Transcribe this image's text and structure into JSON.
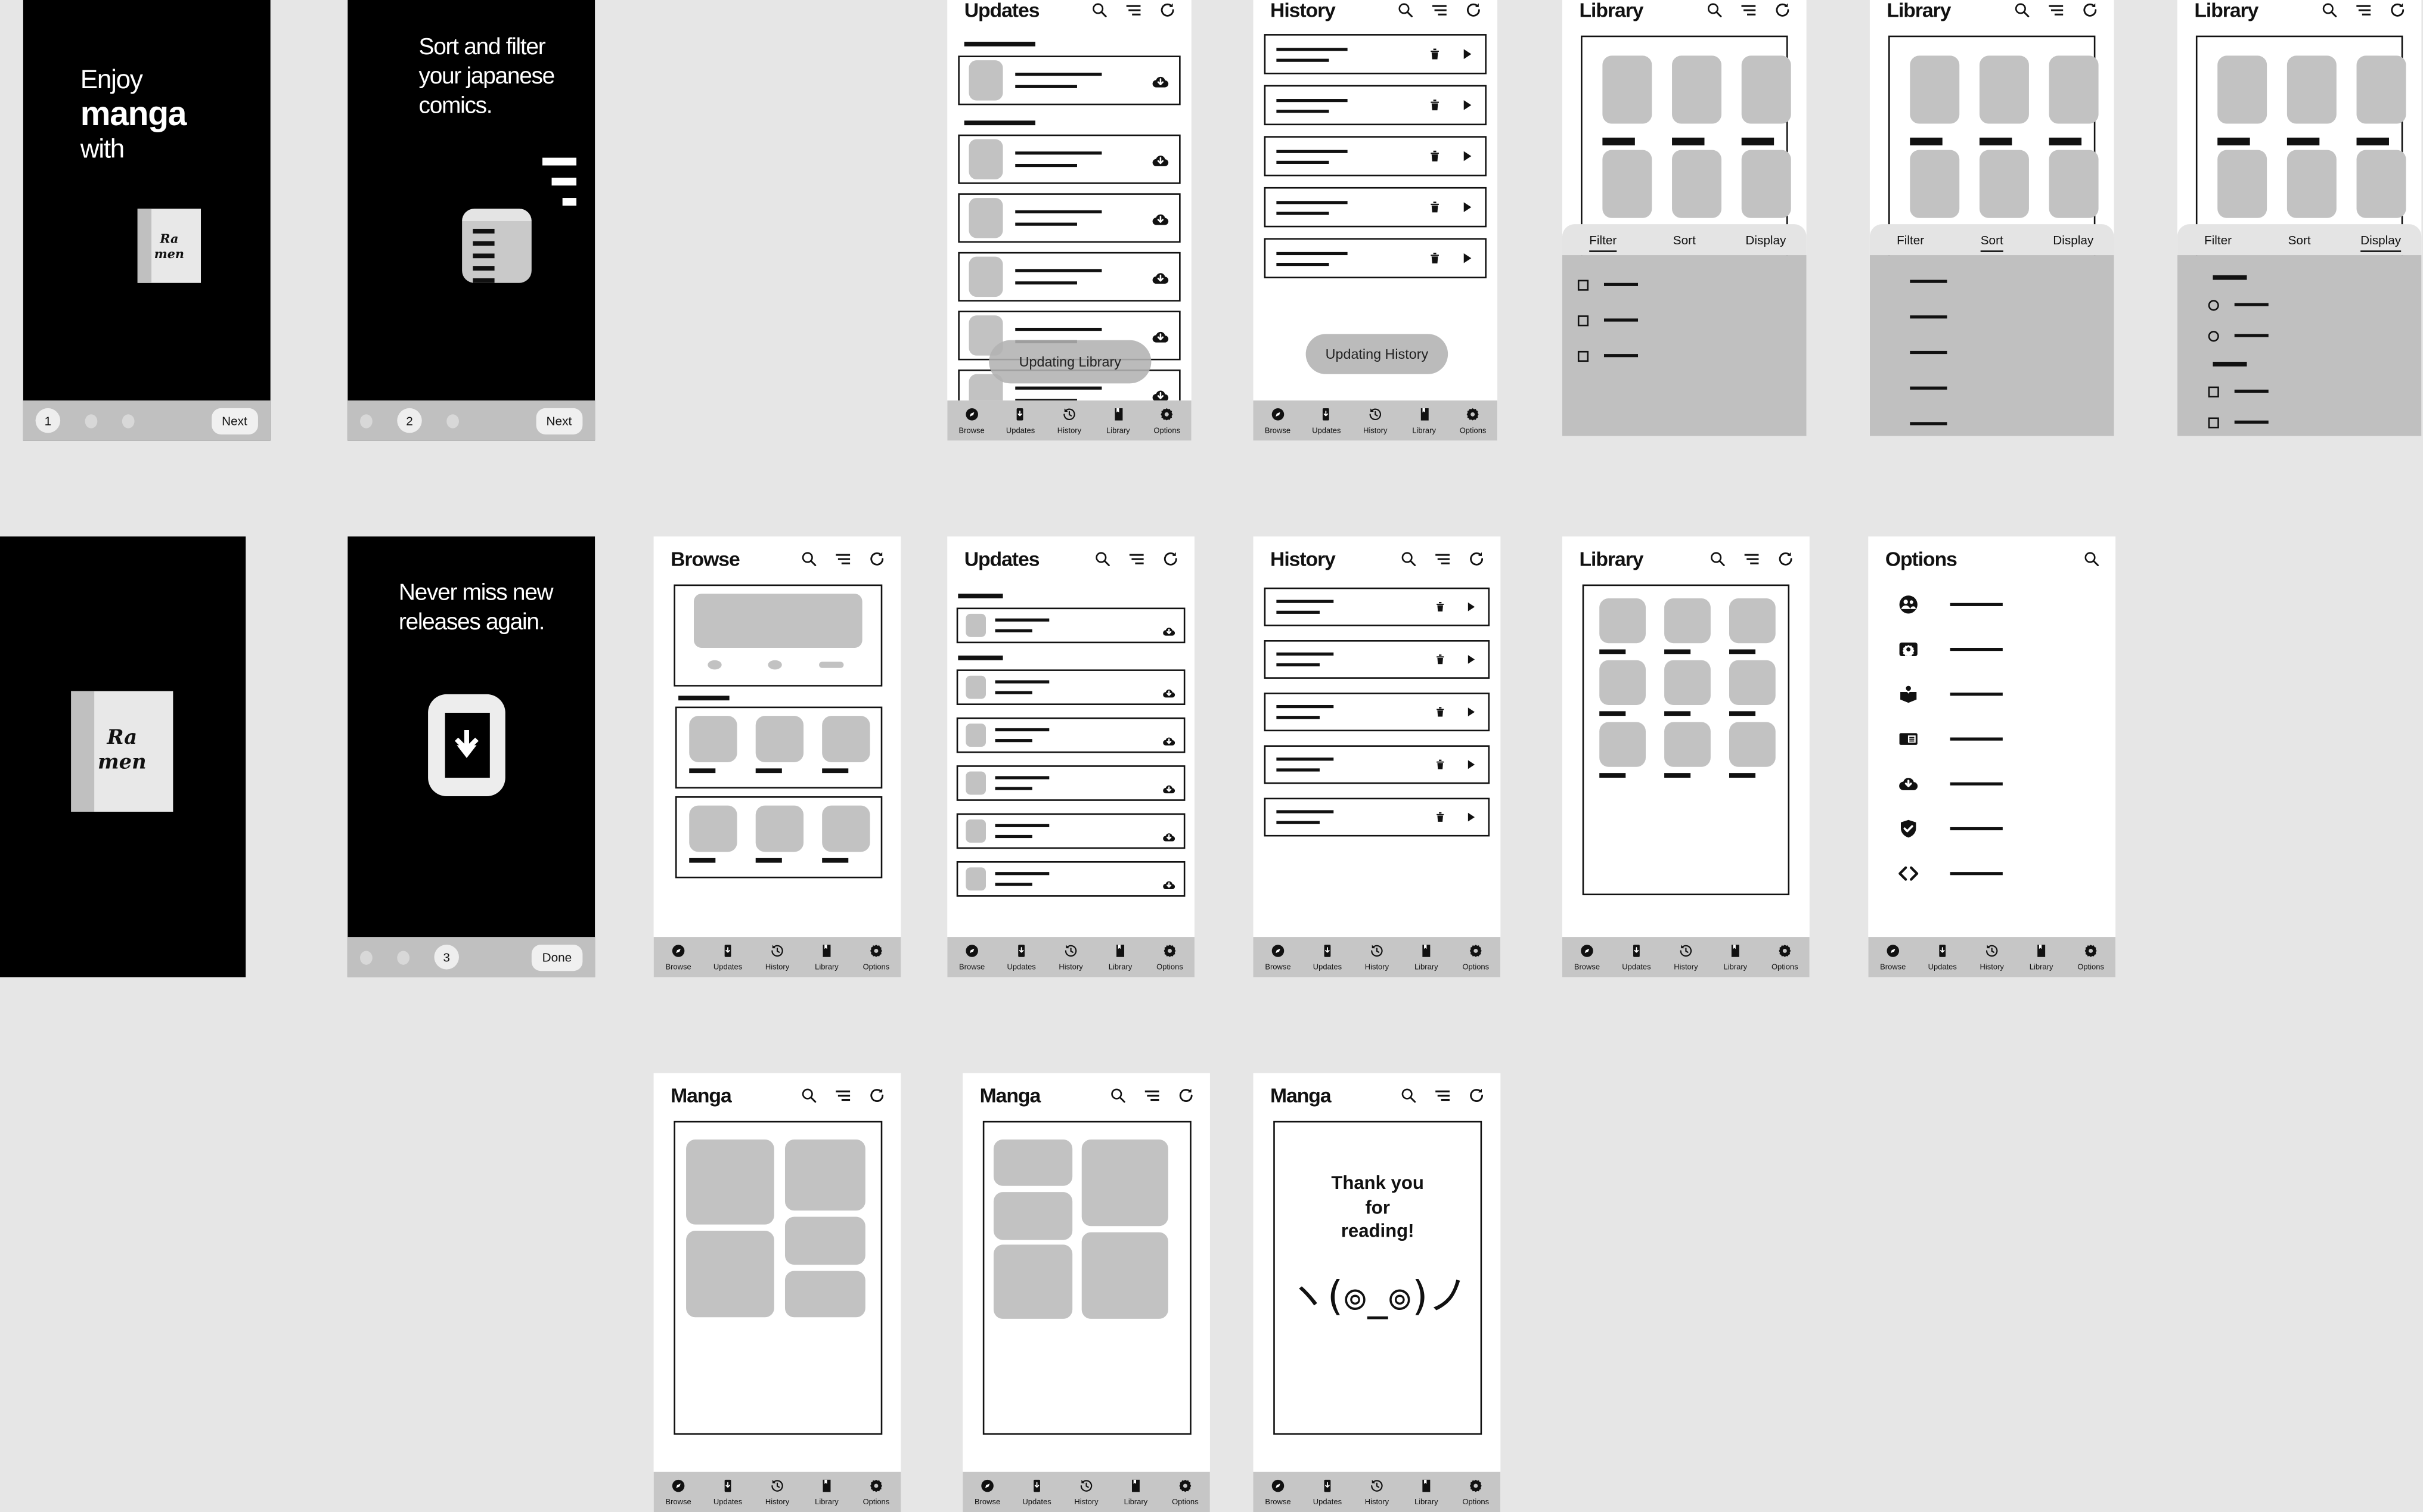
{
  "app": {
    "nav_items": [
      {
        "label": "Browse",
        "icon": "compass-icon"
      },
      {
        "label": "Updates",
        "icon": "phone-download-icon"
      },
      {
        "label": "History",
        "icon": "clock-rewind-icon"
      },
      {
        "label": "Library",
        "icon": "book-icon"
      },
      {
        "label": "Options",
        "icon": "gear-icon"
      }
    ],
    "bar_icons": [
      {
        "name": "search-icon"
      },
      {
        "name": "sort-filter-icon"
      },
      {
        "name": "refresh-icon"
      }
    ]
  },
  "onboarding": [
    {
      "id": "onboarding-1",
      "heading_pre": "Enjoy",
      "heading_big": "manga",
      "heading_post": "with",
      "graphic": "book-cover-ramen",
      "book_text_line1": "Ra",
      "book_text_line2": "men",
      "page_number": "1",
      "active_index": 0,
      "dots": 3,
      "next_label": "Next"
    },
    {
      "id": "onboarding-2",
      "heading": "Sort and filter your japanese comics.",
      "graphic": "sort-and-filter-card",
      "page_number": "2",
      "active_index": 1,
      "dots": 3,
      "next_label": "Next"
    },
    {
      "id": "onboarding-3",
      "heading": "Never miss new releases again.",
      "graphic": "phone-download",
      "page_number": "3",
      "active_index": 2,
      "dots": 3,
      "next_label": "Done"
    }
  ],
  "splash": {
    "id": "splash",
    "book_text_line1": "Ra",
    "book_text_line2": "men"
  },
  "updates_screen": {
    "title": "Updates",
    "toast": "Updating Library",
    "group_count": 2,
    "rows_group1": 1,
    "rows_group2": 5,
    "row_icon": "cloud-download-icon"
  },
  "history_screen": {
    "title": "History",
    "toast": "Updating History",
    "rows": 5,
    "row_icons": [
      "trash-icon",
      "play-icon"
    ]
  },
  "library_screens": [
    {
      "title": "Library",
      "sheet_tabs": [
        "Filter",
        "Sort",
        "Display"
      ],
      "selected_tab": "Filter",
      "sheet_options": [
        {
          "control": "checkbox"
        },
        {
          "control": "checkbox"
        },
        {
          "control": "checkbox"
        }
      ]
    },
    {
      "title": "Library",
      "sheet_tabs": [
        "Filter",
        "Sort",
        "Display"
      ],
      "selected_tab": "Sort",
      "sheet_options": [
        {
          "control": "none"
        },
        {
          "control": "none"
        },
        {
          "control": "none"
        },
        {
          "control": "none"
        },
        {
          "control": "none"
        }
      ]
    },
    {
      "title": "Library",
      "sheet_tabs": [
        "Filter",
        "Sort",
        "Display"
      ],
      "selected_tab": "Display",
      "sheet_options": [
        {
          "control": "header"
        },
        {
          "control": "radio"
        },
        {
          "control": "radio"
        },
        {
          "control": "header"
        },
        {
          "control": "checkbox"
        },
        {
          "control": "checkbox"
        }
      ]
    }
  ],
  "browse_screen": {
    "title": "Browse",
    "hero_pills": 3,
    "section_rows": 2,
    "cards_per_row": 3
  },
  "library_grid_screen": {
    "title": "Library",
    "rows": 3,
    "cols": 3
  },
  "options_screen": {
    "title": "Options",
    "search_icon": "search-icon",
    "items": [
      {
        "icon": "people-circle-icon"
      },
      {
        "icon": "gear-box-icon"
      },
      {
        "icon": "book-reader-icon"
      },
      {
        "icon": "article-reader-icon"
      },
      {
        "icon": "cloud-download-icon"
      },
      {
        "icon": "shield-check-icon"
      },
      {
        "icon": "code-brackets-icon"
      }
    ]
  },
  "manga_screens": [
    {
      "title": "Manga",
      "layout": "panels-a"
    },
    {
      "title": "Manga",
      "layout": "panels-b"
    },
    {
      "title": "Manga",
      "layout": "thank-you",
      "thanks_line1": "Thank you",
      "thanks_line2": "for",
      "thanks_line3": "reading!",
      "kaomoji": "ヽ(๏_๏)ノ"
    }
  ],
  "colors": {
    "canvas": "#e6e6e6",
    "screen": "#ffffff",
    "dark": "#000000",
    "tabbar": "#c6c6c6",
    "placeholder": "#c2c2c2",
    "sheet_tabs": "#e4e4e4",
    "sheet_body": "#c0c0c0",
    "ink": "#111111"
  }
}
